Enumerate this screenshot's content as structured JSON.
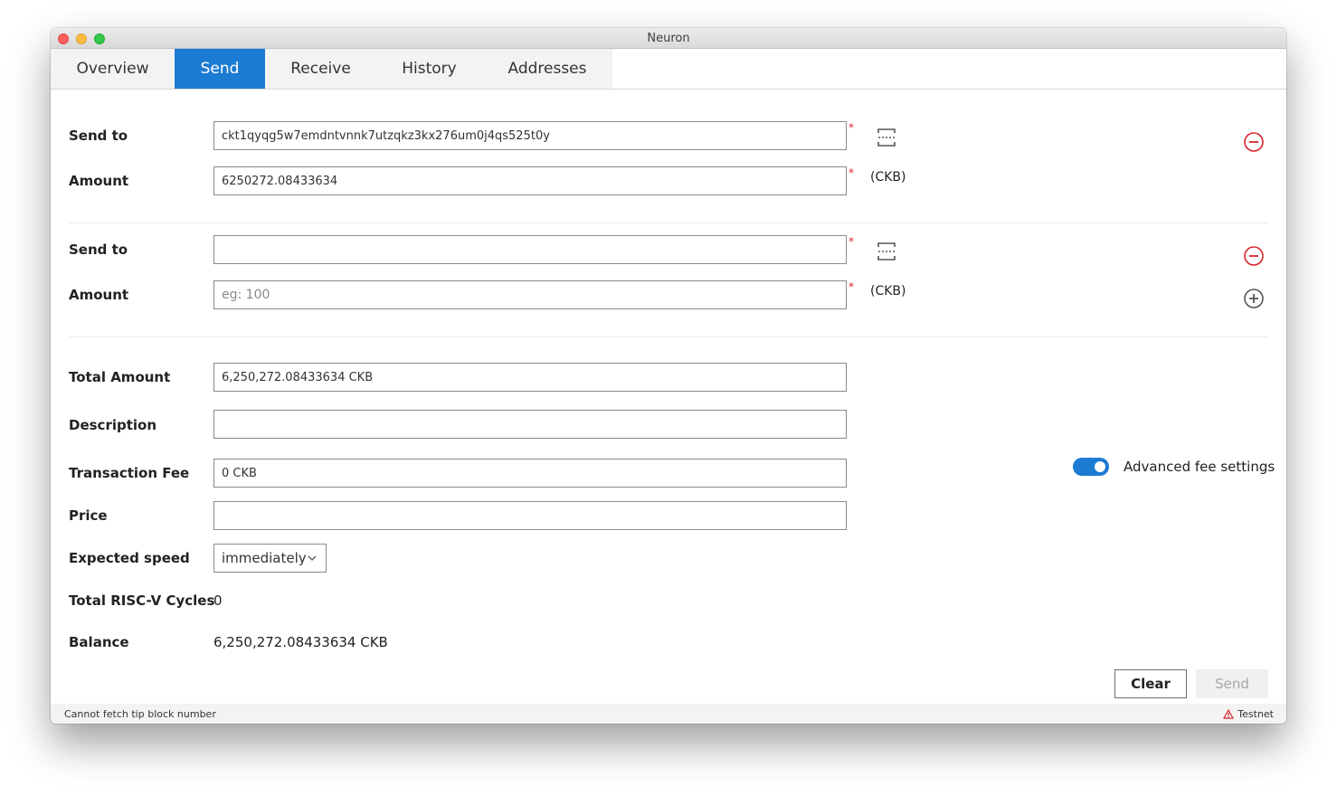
{
  "window": {
    "title": "Neuron"
  },
  "tabs": [
    {
      "label": "Overview"
    },
    {
      "label": "Send"
    },
    {
      "label": "Receive"
    },
    {
      "label": "History"
    },
    {
      "label": "Addresses"
    }
  ],
  "active_tab": "Send",
  "recipients": [
    {
      "send_to_label": "Send to",
      "address_value": "ckt1qyqg5w7emdntvnnk7utzqkz3kx276um0j4qs525t0y",
      "amount_label": "Amount",
      "amount_value": "6250272.08433634",
      "amount_placeholder": "",
      "required_mark": "*",
      "unit": "(CKB)"
    },
    {
      "send_to_label": "Send to",
      "address_value": "",
      "amount_label": "Amount",
      "amount_value": "",
      "amount_placeholder": "eg: 100",
      "required_mark": "*",
      "unit": "(CKB)"
    }
  ],
  "summary": {
    "total_amount_label": "Total Amount",
    "total_amount_value": "6,250,272.08433634 CKB",
    "description_label": "Description",
    "description_value": "",
    "transaction_fee_label": "Transaction Fee",
    "transaction_fee_value": "0 CKB",
    "price_label": "Price",
    "price_value": "",
    "expected_speed_label": "Expected speed",
    "expected_speed_value": "immediately",
    "cycles_label": "Total RISC-V Cycles",
    "cycles_value": "0",
    "balance_label": "Balance",
    "balance_value": "6,250,272.08433634 CKB"
  },
  "advanced_fee": {
    "label": "Advanced fee settings",
    "enabled": true
  },
  "buttons": {
    "clear": "Clear",
    "send": "Send",
    "send_enabled": false
  },
  "status": {
    "left": "Cannot fetch tip block number",
    "network": "Testnet"
  },
  "icons": {
    "scan": "qr-scan-icon",
    "remove": "remove-circle-icon",
    "add": "add-circle-icon",
    "warning": "warning-triangle-icon",
    "chevron": "chevron-down-icon"
  },
  "colors": {
    "accent": "#1c7bd2",
    "danger": "#d9242b"
  }
}
